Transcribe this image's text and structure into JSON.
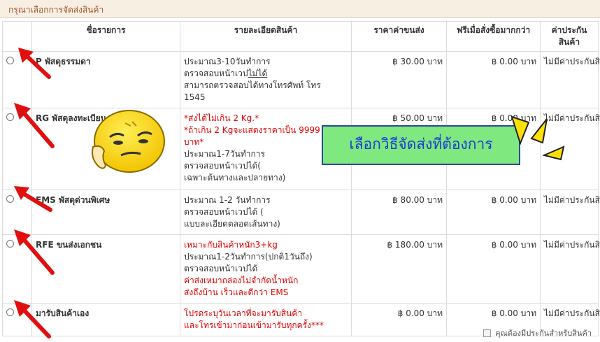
{
  "header": {
    "title": "กรุณาเลือกการจัดส่งสินค้า"
  },
  "table": {
    "columns": [
      "",
      "ชื่อรายการ",
      "รายละเอียดสินค้า",
      "ราคาค่าขนส่ง",
      "ฟรีเมื่อสั่งซื้อมากกว่า",
      "ค่าประกันสินค้า"
    ],
    "rows": [
      {
        "name": "P พัสดุธรรมดา",
        "details": [
          {
            "text": "ประมาณ3-10วันทำการ",
            "color": "normal"
          },
          {
            "text": "ตรวจสอบหน้าเวป",
            "color": "normal",
            "suffix": "ไม่ได้"
          },
          {
            "text": "สามารถตรวจสอบได้ทางโทรศัพท์ โทร",
            "color": "normal"
          },
          {
            "text": "1545",
            "color": "normal"
          }
        ],
        "price": "฿ 30.00 บาท",
        "free": "฿ 0.00 บาท",
        "insurance": "ไม่มีค่าประกันสินค้า"
      },
      {
        "name": "RG พัสดุลงทะเบียน",
        "details": [
          {
            "text": "*ส่งได้ไม่เกิน 2 Kg.*",
            "color": "red"
          },
          {
            "text": "*ถ้าเกิน 2 Kgจะแสดงราคาเป็น 9999",
            "color": "red"
          },
          {
            "text": "บาท*",
            "color": "red"
          },
          {
            "text": "ประมาณ1-7วันทำการ",
            "color": "normal"
          },
          {
            "text": "ตรวจสอบหน้าเวปได้(",
            "color": "normal"
          },
          {
            "text": "เฉพาะต้นทางและปลายทาง)",
            "color": "normal"
          }
        ],
        "price": "฿ 50.00 บาท",
        "free": "฿ 0.00 บาท",
        "insurance": "ไม่มีค่าประกันสินค้า"
      },
      {
        "name": "EMS พัสดุด่วนพิเศษ",
        "details": [
          {
            "text": "ประมาณ 1-2 วันทำการ",
            "color": "normal"
          },
          {
            "text": "ตรวจสอบหน้าเวปได้ (",
            "color": "normal"
          },
          {
            "text": "แบบละเอียดตลอดเส้นทาง)",
            "color": "normal"
          }
        ],
        "price": "฿ 80.00 บาท",
        "free": "฿ 0.00 บาท",
        "insurance": "ไม่มีค่าประกันสินค้า"
      },
      {
        "name": "RFE ขนส่งเอกชน",
        "details": [
          {
            "text": "เหมาะกับสินค้าหนัก3+kg",
            "color": "red"
          },
          {
            "text": "ประมาณ1-2วันทำการ(ปกติ1วันถึง)",
            "color": "normal"
          },
          {
            "text": "ตรวจสอบหน้าเวปได้",
            "color": "normal"
          },
          {
            "text": "ค่าส่งเหมาถล่องไม่จำกัดน้ำหนัก",
            "color": "red"
          },
          {
            "text": "ส่งถึงบ้าน เร็วและดีกว่า EMS",
            "color": "red"
          }
        ],
        "price": "฿ 180.00 บาท",
        "free": "฿ 0.00 บาท",
        "insurance": "ไม่มีค่าประกันสินค้า"
      },
      {
        "name": "มารับสินค้าเอง",
        "details": [
          {
            "text": "โปรดระบุวันเวลาที่จะมารับสินค้า",
            "color": "red"
          },
          {
            "text": "และโทรเข้ามาก่อนเข้ามารับทุกครั้ง***",
            "color": "red"
          }
        ],
        "price": "฿ 0.00 บาท",
        "free": "฿ 0.00 บาท",
        "insurance": "ไม่มีค่าประกันสินค้า"
      }
    ]
  },
  "footer": {
    "insurance_checkbox_label": "คุณต้องมีประกันสำหรับสินค้า"
  },
  "overlay": {
    "banner_text": "เลือกวิธีจัดส่งที่ต้องการ"
  },
  "colors": {
    "accent_red": "#e00000",
    "banner_bg": "#7fe87f",
    "banner_text": "#1b3bd6",
    "header_text": "#a0502a"
  }
}
